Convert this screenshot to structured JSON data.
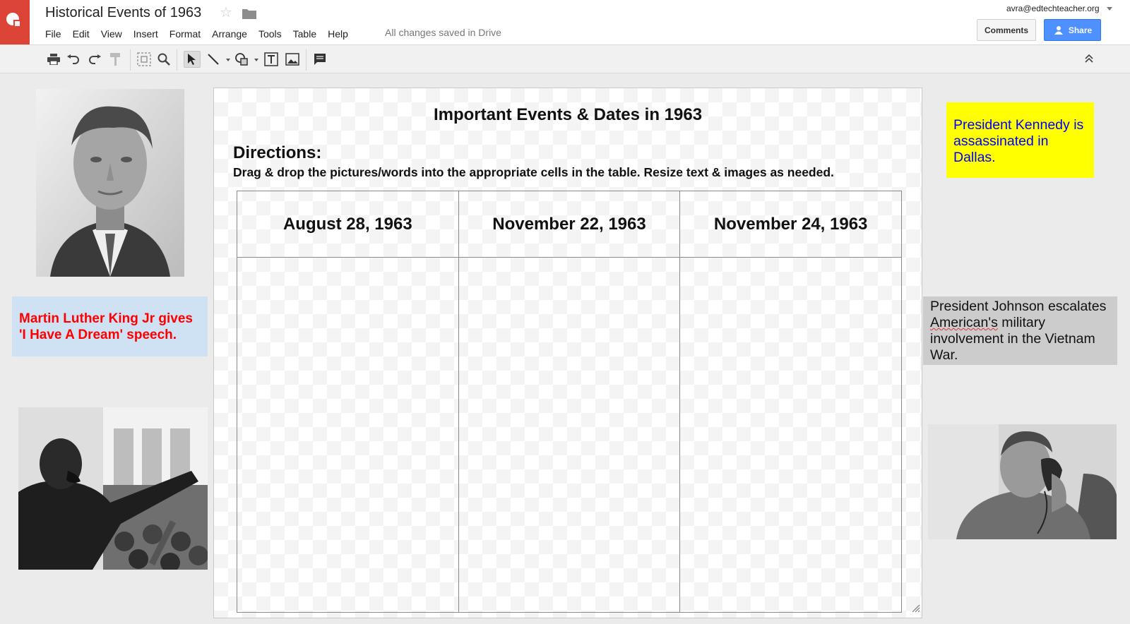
{
  "app": {
    "title": "Historical Events of 1963",
    "save_status": "All changes saved in Drive",
    "account_email": "avra@edtechteacher.org",
    "comments_label": "Comments",
    "share_label": "Share",
    "brand_color": "#db4437",
    "share_color": "#4d90fe"
  },
  "menu": [
    "File",
    "Edit",
    "View",
    "Insert",
    "Format",
    "Arrange",
    "Tools",
    "Table",
    "Help"
  ],
  "toolbar": {
    "icons": [
      "print-icon",
      "undo-icon",
      "redo-icon",
      "paint-format-icon",
      "zoom-fit-icon",
      "zoom-icon",
      "select-icon",
      "line-icon",
      "shape-icon",
      "text-box-icon",
      "image-icon",
      "comment-icon",
      "collapse-icon"
    ],
    "active": "select-icon"
  },
  "slide": {
    "title": "Important Events & Dates in 1963",
    "directions_heading": "Directions:",
    "directions_text": "Drag & drop the pictures/words into the appropriate cells in the table. Resize text & images as needed.",
    "columns": [
      "August 28, 1963",
      "November 22, 1963",
      "November 24, 1963"
    ]
  },
  "board": {
    "note_mlk": "Martin Luther King Jr gives 'I Have A Dream' speech.",
    "note_jfk": "President Kennedy is assassinated in Dallas.",
    "note_lbj_1": "President Johnson escalates ",
    "note_lbj_2": "American's",
    "note_lbj_3": " military involvement in the Vietnam War.",
    "note_colors": {
      "mlk_bg": "#cfe2f3",
      "mlk_text": "#ff0000",
      "jfk_bg": "#ffff00",
      "jfk_text": "#0000ff",
      "lbj_bg": "#cccccc"
    },
    "photos": [
      "jfk-photo",
      "mlk-photo",
      "lbj-photo"
    ]
  }
}
